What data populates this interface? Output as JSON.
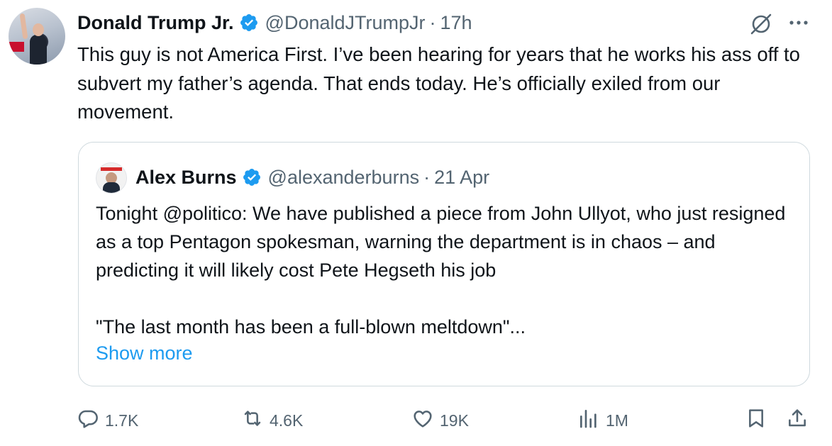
{
  "tweet": {
    "author_name": "Donald Trump Jr.",
    "author_handle": "@DonaldJTrumpJr",
    "separator": "·",
    "time": "17h",
    "text": "This guy is not America First. I’ve been hearing for years that he works his ass off to subvert my father’s agenda. That ends today. He’s officially exiled from our movement."
  },
  "quote": {
    "author_name": "Alex Burns",
    "author_handle": "@alexanderburns",
    "separator": "·",
    "date": "21 Apr",
    "paragraph1": "Tonight @politico: We have published a piece from John Ullyot, who just resigned as a top Pentagon spokesman, warning the department is in chaos – and predicting it will likely cost Pete Hegseth his job",
    "paragraph2": "\"The last month has been a full-blown meltdown\"...",
    "show_more": "Show more"
  },
  "actions": {
    "replies": "1.7K",
    "reposts": "4.6K",
    "likes": "19K",
    "views": "1M"
  },
  "colors": {
    "text": "#0f1419",
    "secondary": "#536471",
    "accent": "#1d9bf0",
    "verified": "#1d9bf0",
    "border": "#cfd9de"
  },
  "icons": [
    "verified-badge-icon",
    "grok-icon",
    "more-icon",
    "reply-icon",
    "repost-icon",
    "like-icon",
    "views-icon",
    "bookmark-icon",
    "share-icon"
  ]
}
